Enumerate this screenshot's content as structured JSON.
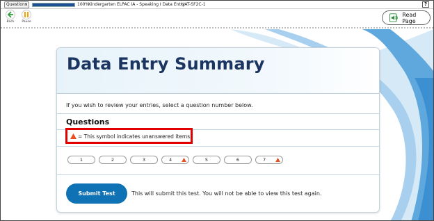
{
  "topbar": {
    "questions_select": "Questions",
    "progress": 100,
    "progress_label": "100%",
    "test_title": "Kindergarten ELPAC IA - Speaking I Data Entry",
    "test_code": "UAT-SF2C-1",
    "help_label": "?"
  },
  "toolbar": {
    "back_label": "Back",
    "pause_label": "Pause",
    "read_page_label": "Read Page"
  },
  "summary": {
    "title": "Data Entry Summary",
    "instruction": "If you wish to review your entries, select a question number below.",
    "questions_heading": "Questions",
    "symbol_note": "= This symbol indicates unanswered items.",
    "questions": [
      {
        "label": "1",
        "unanswered": false
      },
      {
        "label": "2",
        "unanswered": false
      },
      {
        "label": "3",
        "unanswered": false
      },
      {
        "label": "4",
        "unanswered": true
      },
      {
        "label": "5",
        "unanswered": false
      },
      {
        "label": "6",
        "unanswered": false
      },
      {
        "label": "7",
        "unanswered": true
      }
    ],
    "submit_label": "Submit Test",
    "submit_note": "This will submit this test. You will not be able to view this test again."
  },
  "colors": {
    "title": "#1b3460",
    "submit": "#0f72b5",
    "warning": "#e8501f",
    "highlight_box": "#e00000"
  }
}
